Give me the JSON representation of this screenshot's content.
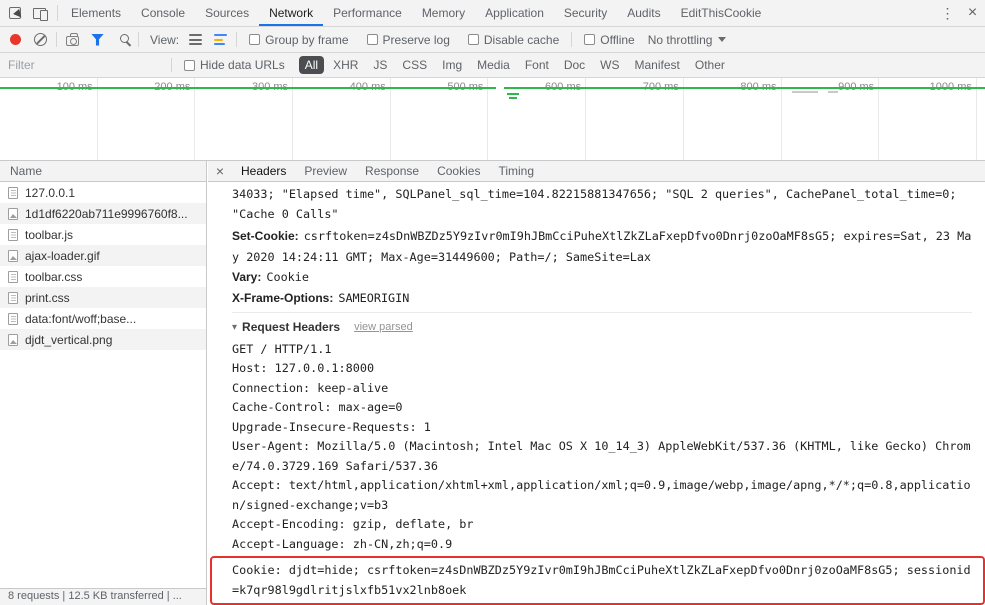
{
  "colors": {
    "accent": "#1a73e8",
    "record_red": "#e8362c",
    "timeline_green": "#2eb84b",
    "annotation_red": "#e8302d"
  },
  "icons": {
    "kebab": "⋮",
    "close": "×",
    "triangle": "▾"
  },
  "devtools": {
    "tabs": [
      "Elements",
      "Console",
      "Sources",
      "Network",
      "Performance",
      "Memory",
      "Application",
      "Security",
      "Audits",
      "EditThisCookie"
    ],
    "active_tab": "Network"
  },
  "toolbar": {
    "view_label": "View:",
    "group_by_frame": "Group by frame",
    "preserve_log": "Preserve log",
    "disable_cache": "Disable cache",
    "offline": "Offline",
    "throttling": "No throttling"
  },
  "filter_bar": {
    "placeholder": "Filter",
    "hide_data_urls": "Hide data URLs",
    "pills": [
      "All",
      "XHR",
      "JS",
      "CSS",
      "Img",
      "Media",
      "Font",
      "Doc",
      "WS",
      "Manifest",
      "Other"
    ],
    "active_pill": "All"
  },
  "timeline": {
    "ticks": [
      "100 ms",
      "200 ms",
      "300 ms",
      "400 ms",
      "500 ms",
      "600 ms",
      "700 ms",
      "800 ms",
      "900 ms",
      "1000 ms"
    ]
  },
  "requests": {
    "header": "Name",
    "items": [
      {
        "name": "127.0.0.1",
        "icon": "doc"
      },
      {
        "name": "1d1df6220ab711e9996760f8...",
        "icon": "img"
      },
      {
        "name": "toolbar.js",
        "icon": "doc"
      },
      {
        "name": "ajax-loader.gif",
        "icon": "img"
      },
      {
        "name": "toolbar.css",
        "icon": "doc"
      },
      {
        "name": "print.css",
        "icon": "doc"
      },
      {
        "name": "data:font/woff;base...",
        "icon": "doc"
      },
      {
        "name": "djdt_vertical.png",
        "icon": "img"
      }
    ]
  },
  "status_bar": {
    "text": "8 requests | 12.5 KB transferred | ..."
  },
  "detail": {
    "tabs": [
      "Headers",
      "Preview",
      "Response",
      "Cookies",
      "Timing"
    ],
    "active_tab": "Headers",
    "response_overflow": "34033; \"Elapsed time\", SQLPanel_sql_time=104.82215881347656; \"SQL 2 queries\", CachePanel_total_time=0; \"Cache 0 Calls\"",
    "response_headers": [
      {
        "name": "Set-Cookie:",
        "value": "csrftoken=z4sDnWBZDz5Y9zIvr0mI9hJBmCciPuheXtlZkZLaFxepDfvo0Dnrj0zoOaMF8sG5; expires=Sat, 23 May 2020 14:24:11 GMT; Max-Age=31449600; Path=/; SameSite=Lax"
      },
      {
        "name": "Vary:",
        "value": "Cookie"
      },
      {
        "name": "X-Frame-Options:",
        "value": "SAMEORIGIN"
      }
    ],
    "request_headers": {
      "title": "Request Headers",
      "action": "view parsed",
      "raw": [
        "GET / HTTP/1.1",
        "Host: 127.0.0.1:8000",
        "Connection: keep-alive",
        "Cache-Control: max-age=0",
        "Upgrade-Insecure-Requests: 1",
        "User-Agent: Mozilla/5.0 (Macintosh; Intel Mac OS X 10_14_3) AppleWebKit/537.36 (KHTML, like Gecko) Chrome/74.0.3729.169 Safari/537.36",
        "Accept: text/html,application/xhtml+xml,application/xml;q=0.9,image/webp,image/apng,*/*;q=0.8,application/signed-exchange;v=b3",
        "Accept-Encoding: gzip, deflate, br",
        "Accept-Language: zh-CN,zh;q=0.9",
        "Cookie: djdt=hide; csrftoken=z4sDnWBZDz5Y9zIvr0mI9hJBmCciPuheXtlZkZLaFxepDfvo0Dnrj0zoOaMF8sG5; sessionid=k7qr98l9gdlritjslxfb51vx2lnb8oek"
      ]
    }
  }
}
